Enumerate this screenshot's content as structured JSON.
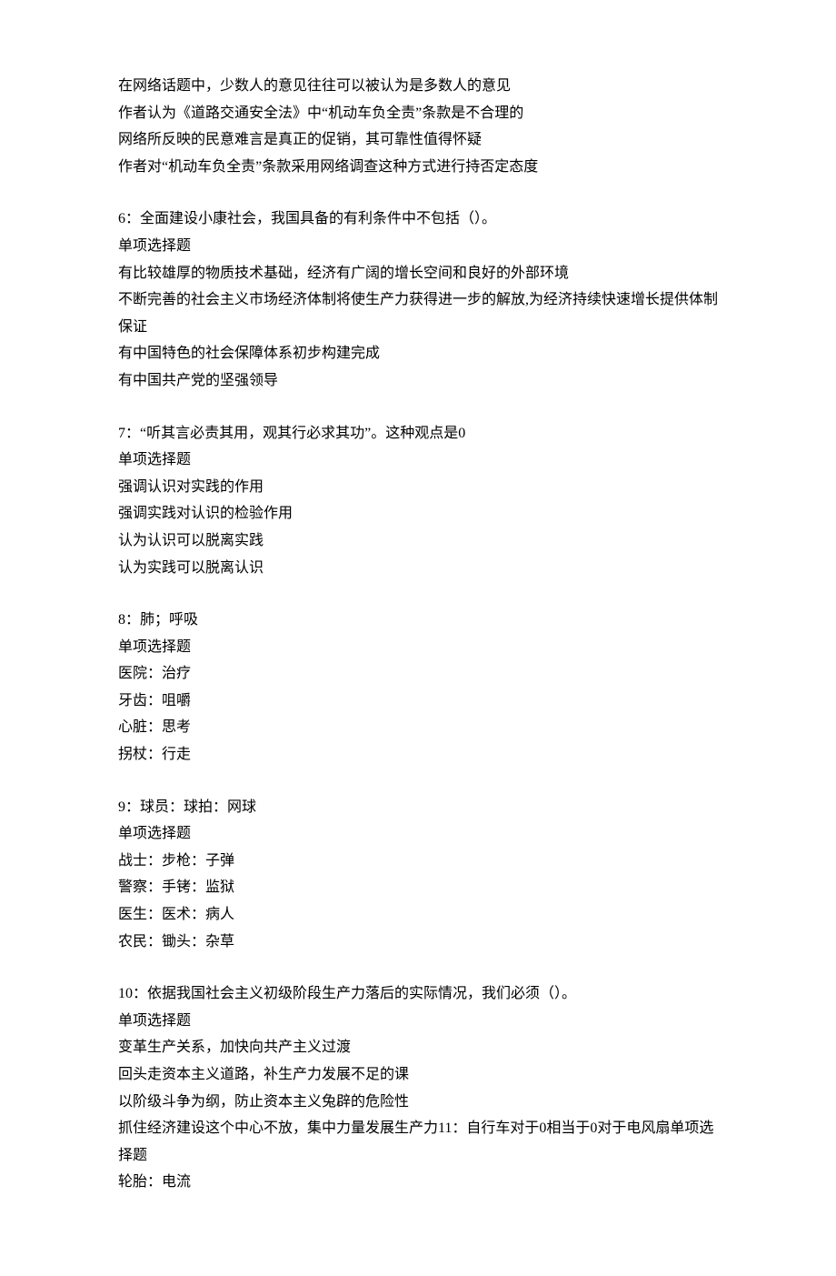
{
  "preamble": {
    "lines": [
      "在网络话题中，少数人的意见往往可以被认为是多数人的意见",
      "作者认为《道路交通安全法》中“机动车负全责”条款是不合理的",
      "网络所反映的民意难言是真正的促销，其可靠性值得怀疑",
      "作者对“机动车负全责”条款采用网络调查这种方式进行持否定态度"
    ]
  },
  "questions": [
    {
      "number": "6：",
      "stem": "全面建设小康社会，我国具备的有利条件中不包括（）。",
      "type": "单项选择题",
      "options": [
        "有比较雄厚的物质技术基础，经济有广阔的增长空间和良好的外部环境",
        "不断完善的社会主义市场经济体制将使生产力获得进一步的解放,为经济持续快速增长提供体制保证",
        "有中国特色的社会保障体系初步构建完成",
        "有中国共产党的坚强领导"
      ]
    },
    {
      "number": "7：",
      "stem": "“听其言必责其用，观其行必求其功”。这种观点是0",
      "type": "单项选择题",
      "options": [
        "强调认识对实践的作用",
        "强调实践对认识的检验作用",
        "认为认识可以脱离实践",
        "认为实践可以脱离认识"
      ]
    },
    {
      "number": "8：",
      "stem": "肺；呼吸",
      "type": "单项选择题",
      "options": [
        "医院：治疗",
        "牙齿：咀嚼",
        "心脏：思考",
        "拐杖：行走"
      ]
    },
    {
      "number": "9：",
      "stem": "球员：球拍：网球",
      "type": "单项选择题",
      "options": [
        "战士：步枪：子弹",
        "警察：手铐：监狱",
        "医生：医术：病人",
        "农民：锄头：杂草"
      ]
    },
    {
      "number": "10：",
      "stem": "依据我国社会主义初级阶段生产力落后的实际情况，我们必须（）。",
      "type": "单项选择题",
      "options": [
        "变革生产关系，加快向共产主义过渡",
        "回头走资本主义道路，补生产力发展不足的课",
        "以阶级斗争为纲，防止资本主义兔辟的危险性",
        "抓住经济建设这个中心不放，集中力量发展生产力11：自行车对于0相当于0对于电风扇单项选择题",
        "轮胎：电流"
      ]
    }
  ]
}
